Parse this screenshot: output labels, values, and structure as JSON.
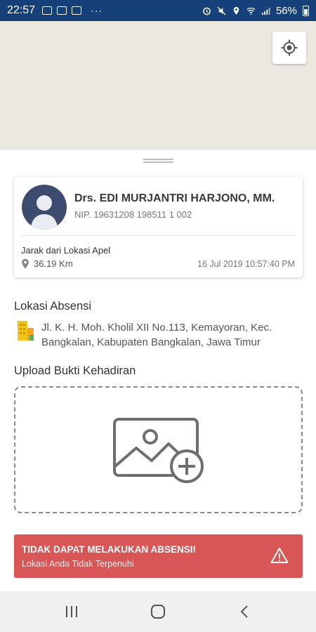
{
  "status_bar": {
    "time": "22:57",
    "dots": "···",
    "battery": "56%"
  },
  "profile": {
    "name": "Drs. EDI MURJANTRI HARJONO, MM.",
    "nip": "NIP. 19631208 198511 1 002",
    "distance_label": "Jarak dari Lokasi Apel",
    "distance_value": "36.19 Km",
    "timestamp": "16 Jul 2019 10:57:40 PM"
  },
  "location": {
    "title": "Lokasi Absensi",
    "address": "Jl. K. H. Moh. Kholil XII No.113, Kemayoran, Kec. Bangkalan, Kabupaten Bangkalan, Jawa Timur"
  },
  "upload": {
    "title": "Upload Bukti Kehadiran"
  },
  "alert": {
    "title": "TIDAK DAPAT MELAKUKAN ABSENSI!",
    "subtitle": "Lokasi Anda Tidak Terpenuhi",
    "color": "#d85756"
  },
  "icons": {
    "locate": "my-location-icon",
    "pin": "map-pin-icon",
    "building": "building-icon",
    "add_image": "add-image-icon",
    "warning": "warning-icon"
  },
  "colors": {
    "status_bar": "#16407a",
    "map_bg": "#ebe8e0",
    "avatar": "#3d4b6e"
  }
}
